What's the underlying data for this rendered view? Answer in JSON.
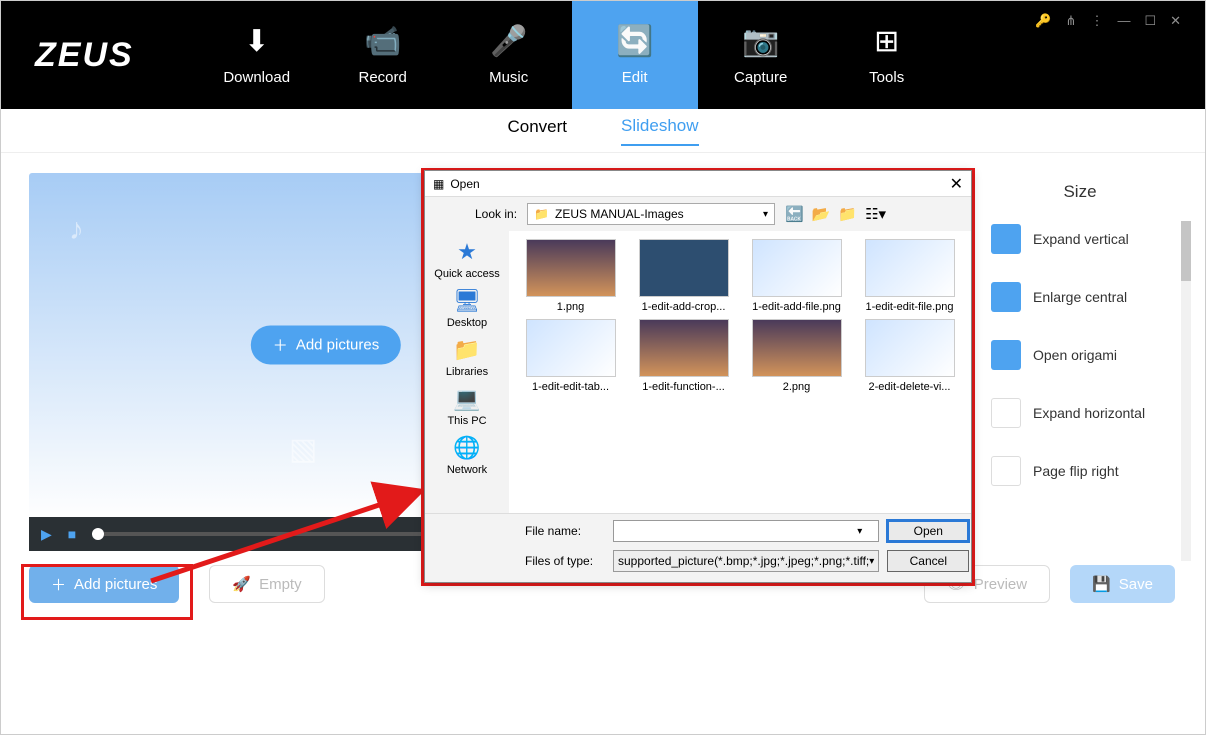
{
  "app": {
    "logo": "ZEUS"
  },
  "nav": [
    {
      "label": "Download",
      "icon": "⬇"
    },
    {
      "label": "Record",
      "icon": "📹"
    },
    {
      "label": "Music",
      "icon": "🎤"
    },
    {
      "label": "Edit",
      "icon": "🔄",
      "active": true
    },
    {
      "label": "Capture",
      "icon": "📷"
    },
    {
      "label": "Tools",
      "icon": "⊞"
    }
  ],
  "subtabs": {
    "convert": "Convert",
    "slideshow": "Slideshow"
  },
  "canvas": {
    "add_btn": "Add pictures"
  },
  "bottom": {
    "add_pictures": "Add pictures",
    "empty": "Empty",
    "preview": "Preview",
    "save": "Save"
  },
  "side": {
    "title": "Size",
    "items": [
      "Expand vertical",
      "Enlarge central",
      "Open origami",
      "Expand horizontal",
      "Page flip right"
    ]
  },
  "dialog": {
    "title": "Open",
    "lookin_label": "Look in:",
    "lookin_value": "ZEUS MANUAL-Images",
    "places": [
      {
        "label": "Quick access",
        "icon": "★"
      },
      {
        "label": "Desktop",
        "icon": "🖥"
      },
      {
        "label": "Libraries",
        "icon": "📁"
      },
      {
        "label": "This PC",
        "icon": "💻"
      },
      {
        "label": "Network",
        "icon": "🌐"
      }
    ],
    "files": [
      {
        "label": "1.png",
        "kind": "photo"
      },
      {
        "label": "1-edit-add-crop...",
        "kind": "app"
      },
      {
        "label": "1-edit-add-file.png",
        "kind": "shot"
      },
      {
        "label": "1-edit-edit-file.png",
        "kind": "shot"
      },
      {
        "label": "1-edit-edit-tab...",
        "kind": "shot"
      },
      {
        "label": "1-edit-function-...",
        "kind": "photo"
      },
      {
        "label": "2.png",
        "kind": "photo"
      },
      {
        "label": "2-edit-delete-vi...",
        "kind": "shot"
      }
    ],
    "filename_label": "File name:",
    "filename_value": "",
    "filetype_label": "Files of type:",
    "filetype_value": "supported_picture(*.bmp;*.jpg;*.jpeg;*.png;*.tiff;",
    "open_btn": "Open",
    "cancel_btn": "Cancel"
  }
}
